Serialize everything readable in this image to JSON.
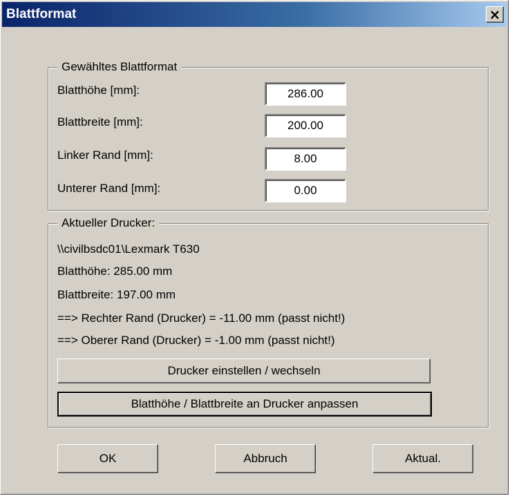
{
  "window": {
    "title": "Blattformat",
    "close_glyph": "×"
  },
  "selected_format": {
    "legend": "Gewähltes Blattformat",
    "fields": [
      {
        "label": "Blatthöhe [mm]:",
        "value": "286.00"
      },
      {
        "label": "Blattbreite [mm]:",
        "value": "200.00"
      },
      {
        "label": "Linker Rand [mm]:",
        "value": "8.00"
      },
      {
        "label": "Unterer Rand [mm]:",
        "value": "0.00"
      }
    ]
  },
  "printer": {
    "legend": "Aktueller Drucker:",
    "lines": [
      "\\\\civilbsdc01\\Lexmark T630",
      "Blatthöhe:  285.00 mm",
      "Blattbreite: 197.00 mm",
      "==> Rechter Rand (Drucker) = -11.00 mm  (passt nicht!)",
      "==> Oberer Rand (Drucker) = -1.00 mm  (passt nicht!)"
    ],
    "setup_button": "Drucker einstellen / wechseln",
    "fit_button": "Blatthöhe / Blattbreite an Drucker anpassen"
  },
  "footer": {
    "ok": "OK",
    "cancel": "Abbruch",
    "refresh": "Aktual."
  }
}
